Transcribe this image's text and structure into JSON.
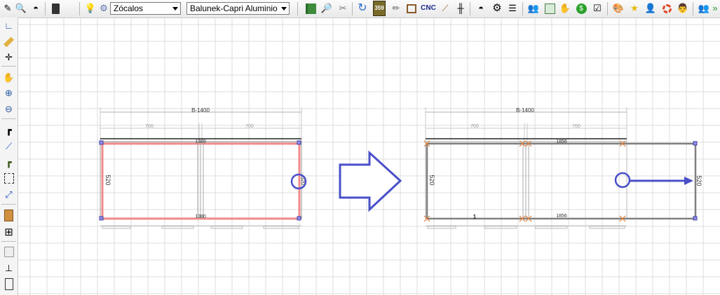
{
  "toolbar": {
    "pre_icons": [
      "pencil-dimension-icon",
      "zoom-page-icon",
      "measure-icon",
      "calculator-icon",
      "lightbulb-icon"
    ],
    "gear_icon": "gear-icon",
    "dropdown_plinth": {
      "value": "Zócalos"
    },
    "dropdown_profile": {
      "value": "Balunek-Capri Aluminio"
    },
    "icons_1": [
      "book-icon",
      "preview-icon",
      "tools-icon"
    ],
    "refresh_icon": "refresh-icon",
    "badge_359": "359",
    "icons_2": [
      "pencil-icon",
      "frame-icon"
    ],
    "cnc_label": "CNC",
    "icons_3": [
      "cut-icon",
      "mullion-icon",
      "measure-tape-icon",
      "settings-gear-icon",
      "list-icon",
      "users-icon",
      "window-icon",
      "hand-icon",
      "dollar-icon",
      "checkbox-icon",
      "palette-icon",
      "star-icon",
      "user-icon",
      "lifebuoy-icon",
      "person-icon",
      "group-icon"
    ]
  },
  "sidebar": {
    "icons": [
      "angle-icon",
      "ruler-icon",
      "crosshair-icon",
      "hand-move-icon",
      "zoom-in-icon",
      "zoom-out-icon",
      "profile-corner-icon",
      "line-icon",
      "profile-l-icon",
      "selection-icon",
      "diagonal-icon",
      "door-icon",
      "grid-icon",
      "panel-icon",
      "stamp-icon",
      "door-small-icon"
    ]
  },
  "before": {
    "total_label": "B-1400",
    "segment_labels": [
      "700",
      "700"
    ],
    "top_value": "1389",
    "bottom_value": "1380",
    "left_height": "520",
    "right_height": "520"
  },
  "after": {
    "total_label": "B-1400",
    "segment_labels": [
      "700",
      "700"
    ],
    "top_value": "1856",
    "bottom_value": "1856",
    "left_height": "520",
    "right_height": "520",
    "marker": "1"
  },
  "colors": {
    "grid": "#dcdcdc",
    "selected_frame": "#f08a8a",
    "frame": "#808080",
    "annotation": "#4a50c8",
    "dimension": "#b0b0b0",
    "handle": "#e0803a"
  }
}
